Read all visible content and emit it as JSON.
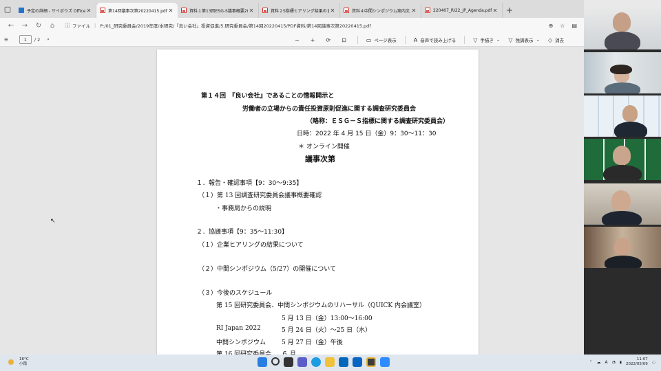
{
  "tabs": [
    {
      "title": "予定の詳細 - サイボウズ Office",
      "icon": "cybozu-icon",
      "active": false
    },
    {
      "title": "第14回議事次第20220415.pdf",
      "icon": "pdf-icon",
      "active": true
    },
    {
      "title": "資料１第13回ESG-S議事概要20210",
      "icon": "pdf-icon",
      "active": false
    },
    {
      "title": "資料２S指標ヒアリング結果のまとめ",
      "icon": "pdf-icon",
      "active": false
    },
    {
      "title": "資料４中間シンポジウム案内文.pdf",
      "icon": "pdf-icon",
      "active": false
    },
    {
      "title": "220407_RI22_JP_Agenda.pdf",
      "icon": "pdf-icon",
      "active": false
    }
  ],
  "address": {
    "label": "ファイル",
    "url": "P:/01_研究委員会/2019年度/本研究/「良い会社」投資促進/5.研究委員会/第14回20220415/PDF資料/第14回議事次第20220415.pdf"
  },
  "pdf_toolbar": {
    "page_current": "1",
    "page_total": "/ 2",
    "page_view": "ページ表示",
    "read_aloud": "音声で読み上げる",
    "draw": "手描き",
    "highlight": "強調表示",
    "erase": "消去"
  },
  "document": {
    "heading1": "第１４回　『良い会社』であることの情報開示と",
    "heading2": "労働者の立場からの責任投資原則促進に関する調査研究委員会",
    "heading3": "（略称：ＥＳＧ－Ｓ指標に関する調査研究委員会）",
    "date": "日時：2022 年 4 月 15 日（金）9：30～11：30",
    "online": "＊ オンライン開催",
    "agenda_title": "議事次第",
    "lines": [
      "１．報告・確認事項【9：30～9:35】",
      "（１）第 13 回調査研究委員会議事概要確認",
      "・事務局からの説明",
      "２．協議事項【9：35～11:30】",
      "（１）企業ヒアリングの結果について",
      "（２）中間シンポジウム（5/27）の開催について",
      "（３）今後のスケジュール",
      "第 15 回研究委員会、中間シンポジウムのリハーサル（QUICK 内会議室）",
      "5 月 13 日（金）13:00～16:00",
      "RI Japan 2022",
      "5 月 24 日（火）～25 日（水）",
      "中間シンポジウム",
      "5 月 27 日（金）午後",
      "第 16 回研究委員会",
      "６ 月"
    ]
  },
  "taskbar": {
    "temperature": "16°C",
    "weather": "小雨",
    "time": "11:07",
    "date": "2022/05/09",
    "ime": "A"
  }
}
